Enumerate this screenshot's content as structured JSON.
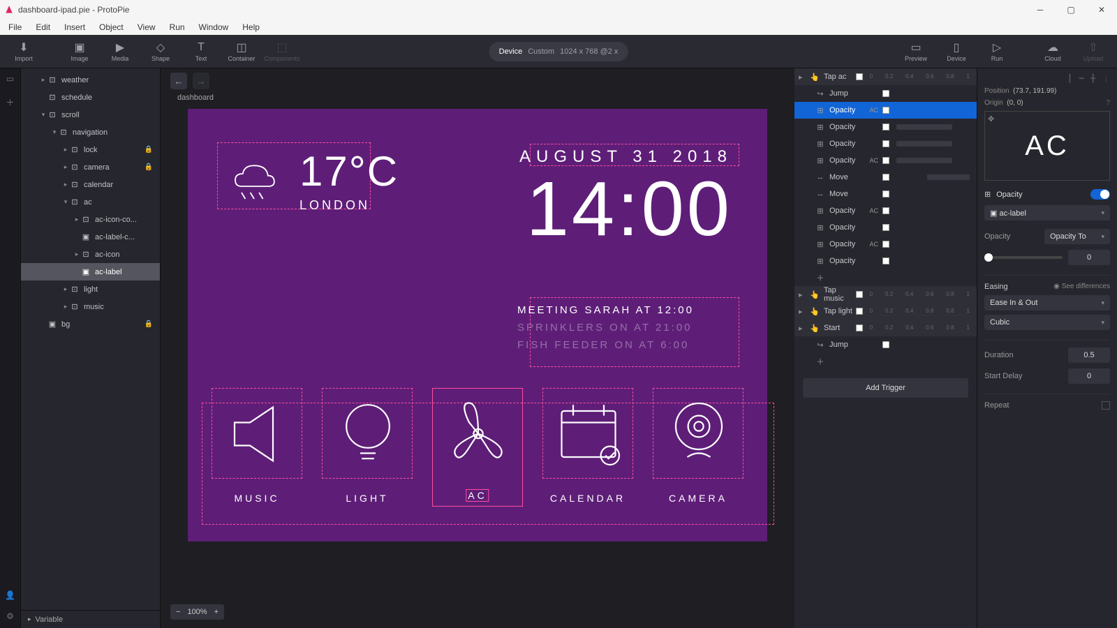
{
  "app": {
    "title": "dashboard-ipad.pie - ProtoPie"
  },
  "menubar": [
    "File",
    "Edit",
    "Insert",
    "Object",
    "View",
    "Run",
    "Window",
    "Help"
  ],
  "toolbar": {
    "left": [
      {
        "id": "import",
        "label": "Import"
      },
      {
        "id": "image",
        "label": "Image"
      },
      {
        "id": "media",
        "label": "Media"
      },
      {
        "id": "shape",
        "label": "Shape"
      },
      {
        "id": "text",
        "label": "Text"
      },
      {
        "id": "container",
        "label": "Container"
      },
      {
        "id": "components",
        "label": "Components"
      }
    ],
    "device": {
      "label": "Device",
      "mode": "Custom",
      "size": "1024 x 768 @2 x"
    },
    "right": [
      {
        "id": "preview",
        "label": "Preview"
      },
      {
        "id": "device",
        "label": "Device"
      },
      {
        "id": "run",
        "label": "Run"
      },
      {
        "id": "cloud",
        "label": "Cloud"
      },
      {
        "id": "upload",
        "label": "Upload"
      }
    ]
  },
  "layers": [
    {
      "name": "weather",
      "depth": 1,
      "arrow": "▸",
      "icon": "container"
    },
    {
      "name": "schedule",
      "depth": 1,
      "arrow": "",
      "icon": "container"
    },
    {
      "name": "scroll",
      "depth": 1,
      "arrow": "▾",
      "icon": "container"
    },
    {
      "name": "navigation",
      "depth": 2,
      "arrow": "▾",
      "icon": "container"
    },
    {
      "name": "lock",
      "depth": 3,
      "arrow": "▸",
      "icon": "container",
      "locked": true
    },
    {
      "name": "camera",
      "depth": 3,
      "arrow": "▸",
      "icon": "container",
      "locked": true
    },
    {
      "name": "calendar",
      "depth": 3,
      "arrow": "▸",
      "icon": "container"
    },
    {
      "name": "ac",
      "depth": 3,
      "arrow": "▾",
      "icon": "container"
    },
    {
      "name": "ac-icon-co...",
      "depth": 4,
      "arrow": "▸",
      "icon": "container"
    },
    {
      "name": "ac-label-c...",
      "depth": 4,
      "arrow": "",
      "icon": "image"
    },
    {
      "name": "ac-icon",
      "depth": 4,
      "arrow": "▸",
      "icon": "container"
    },
    {
      "name": "ac-label",
      "depth": 4,
      "arrow": "",
      "icon": "image",
      "selected": true
    },
    {
      "name": "light",
      "depth": 3,
      "arrow": "▸",
      "icon": "container"
    },
    {
      "name": "music",
      "depth": 3,
      "arrow": "▸",
      "icon": "container"
    },
    {
      "name": "bg",
      "depth": 1,
      "arrow": "",
      "icon": "image",
      "locked": true
    }
  ],
  "variableFooter": "Variable",
  "canvas": {
    "sceneLabel": "dashboard",
    "zoom": "100%",
    "weather": {
      "temp": "17°C",
      "city": "LONDON"
    },
    "date": "AUGUST 31 2018",
    "time": "14:00",
    "events": [
      {
        "text": "MEETING SARAH AT 12:00",
        "dim": false
      },
      {
        "text": "SPRINKLERS ON AT 21:00",
        "dim": true
      },
      {
        "text": "FISH FEEDER ON AT 6:00",
        "dim": true
      }
    ],
    "nav": [
      {
        "label": "MUSIC"
      },
      {
        "label": "LIGHT"
      },
      {
        "label": "AC"
      },
      {
        "label": "CALENDAR"
      },
      {
        "label": "CAMERA"
      }
    ]
  },
  "triggers": {
    "groups": [
      {
        "name": "Tap ac",
        "rows": [
          {
            "type": "Jump",
            "badge": "",
            "sq": true
          },
          {
            "type": "Opacity",
            "badge": "AC",
            "selected": true,
            "bar": "blue"
          },
          {
            "type": "Opacity",
            "badge": "",
            "bar": "grey"
          },
          {
            "type": "Opacity",
            "badge": "",
            "bar": "grey"
          },
          {
            "type": "Opacity",
            "badge": "AC",
            "bar": "grey"
          },
          {
            "type": "Move",
            "badge": "",
            "bar": "grey2"
          },
          {
            "type": "Move",
            "badge": ""
          },
          {
            "type": "Opacity",
            "badge": "AC"
          },
          {
            "type": "Opacity",
            "badge": ""
          },
          {
            "type": "Opacity",
            "badge": "AC"
          },
          {
            "type": "Opacity",
            "badge": ""
          },
          {
            "type": "+",
            "badge": ""
          }
        ]
      },
      {
        "name": "Tap music",
        "rows": []
      },
      {
        "name": "Tap light",
        "rows": []
      },
      {
        "name": "Start",
        "rows": [
          {
            "type": "Jump",
            "badge": "",
            "sq": true
          },
          {
            "type": "+",
            "badge": ""
          }
        ]
      }
    ],
    "addTrigger": "Add Trigger",
    "ruler": [
      "0",
      "0.2",
      "0.4",
      "0.6",
      "0.8",
      "1"
    ]
  },
  "inspector": {
    "position": "Position",
    "positionVal": "(73.7, 191.99)",
    "origin": "Origin",
    "originVal": "(0, 0)",
    "previewText": "AC",
    "opacityHeader": "Opacity",
    "targetLayer": "ac-label",
    "opacityLabel": "Opacity",
    "opacityMode": "Opacity To",
    "opacityValue": "0",
    "easingLabel": "Easing",
    "seeDiff": "See differences",
    "easingCurve": "Ease In & Out",
    "easingType": "Cubic",
    "durationLabel": "Duration",
    "durationVal": "0.5",
    "delayLabel": "Start Delay",
    "delayVal": "0",
    "repeatLabel": "Repeat"
  }
}
